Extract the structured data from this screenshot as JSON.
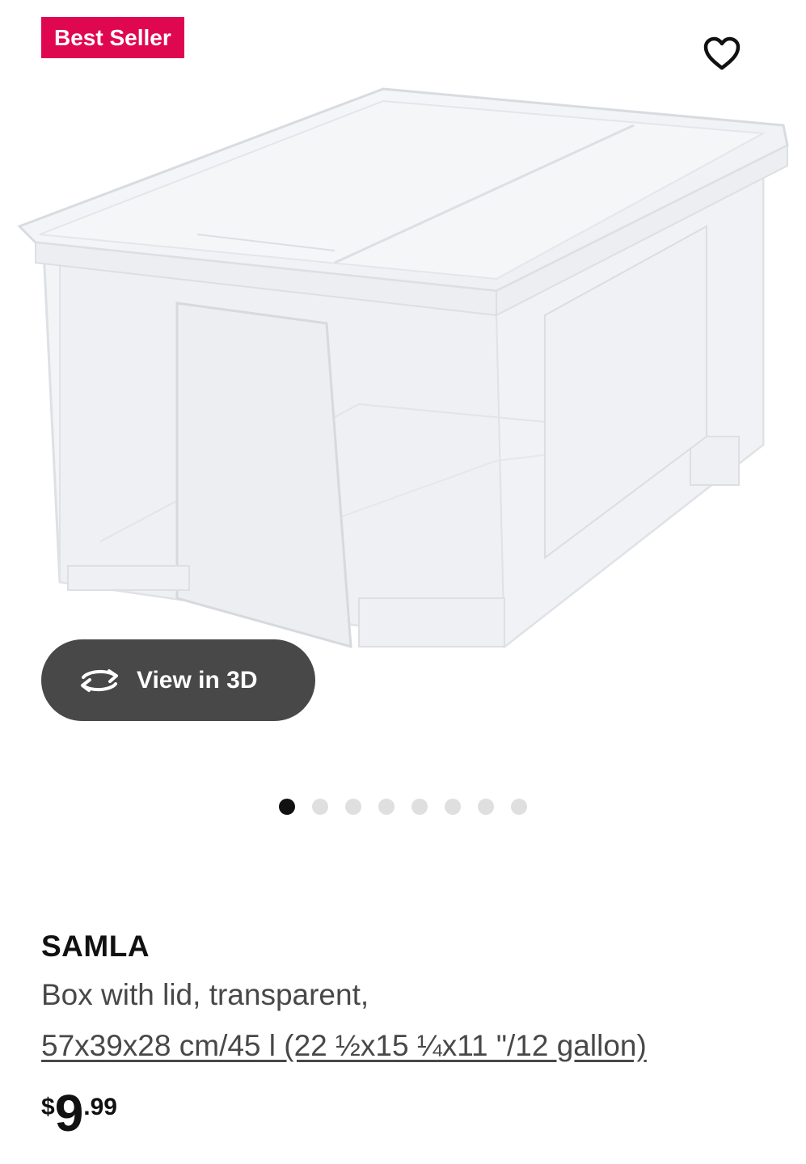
{
  "badge": {
    "label": "Best Seller",
    "color": "#e00751"
  },
  "favorite": {
    "icon": "heart-outline-icon"
  },
  "product_image": {
    "alt": "SAMLA box with lid, transparent"
  },
  "view3d": {
    "label": "View in 3D",
    "icon": "rotate-3d-icon"
  },
  "carousel": {
    "total": 8,
    "active_index": 0
  },
  "product": {
    "name": "SAMLA",
    "description": "Box with lid, transparent,",
    "size": "57x39x28 cm/45 l (22 ½x15 ¼x11 \"/12 gallon)"
  },
  "price": {
    "currency": "$",
    "integer": "9",
    "decimal": ".99"
  }
}
